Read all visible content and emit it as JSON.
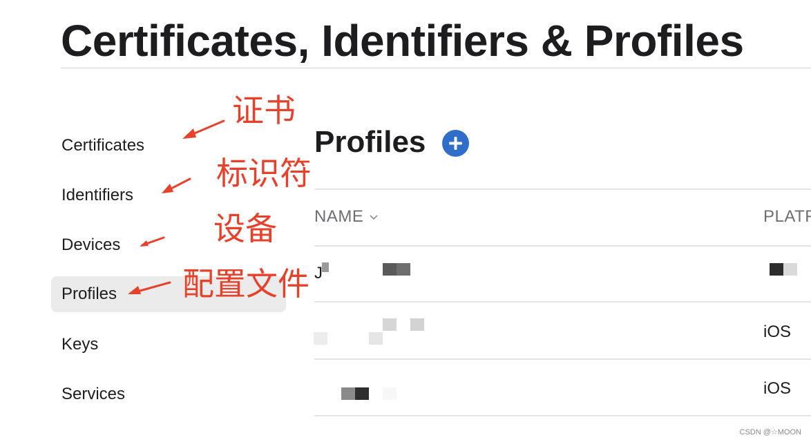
{
  "header": {
    "title": "Certificates, Identifiers & Profiles"
  },
  "sidebar": {
    "items": [
      {
        "label": "Certificates"
      },
      {
        "label": "Identifiers"
      },
      {
        "label": "Devices"
      },
      {
        "label": "Profiles",
        "active": true
      },
      {
        "label": "Keys"
      },
      {
        "label": "Services"
      }
    ]
  },
  "main": {
    "section_title": "Profiles",
    "add_icon": "plus-circle-icon",
    "columns": {
      "name": "NAME",
      "platform": "PLATF"
    },
    "sort_icon": "chevron-down-icon",
    "rows": [
      {
        "name": "J",
        "platform": ""
      },
      {
        "name": "",
        "platform": "iOS"
      },
      {
        "name": "",
        "platform": "iOS"
      }
    ]
  },
  "annotations": {
    "certificates": "证书",
    "identifiers": "标识符",
    "devices": "设备",
    "profiles": "配置文件"
  },
  "watermark": "CSDN @☆MOON",
  "colors": {
    "accent": "#2f6ec9",
    "annotation": "#e8412b",
    "active_bg": "#ebebeb"
  }
}
